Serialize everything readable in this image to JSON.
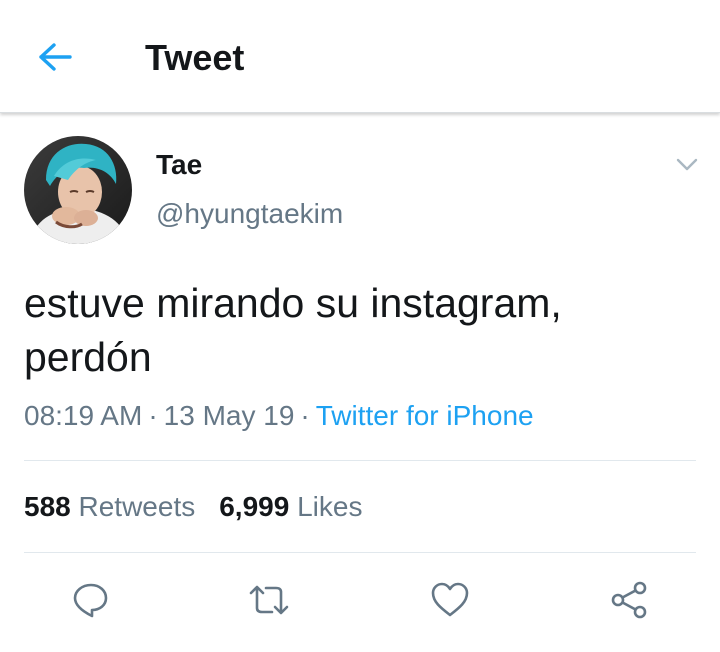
{
  "header": {
    "title": "Tweet",
    "back_icon": "arrow-left-icon"
  },
  "tweet": {
    "author": {
      "display_name": "Tae",
      "handle": "@hyungtaekim"
    },
    "text": "estuve mirando su instagram,\nperdón",
    "time": "08:19 AM",
    "date": "13 May 19",
    "source": "Twitter for iPhone",
    "separator": "·"
  },
  "stats": {
    "retweets_count": "588",
    "retweets_label": "Retweets",
    "likes_count": "6,999",
    "likes_label": "Likes"
  },
  "actions": [
    "reply-icon",
    "retweet-icon",
    "like-icon",
    "share-icon"
  ],
  "colors": {
    "accent": "#1da1f2",
    "text": "#14171a",
    "secondary": "#657786",
    "icon": "#657786",
    "divider": "#e1e8ed"
  }
}
